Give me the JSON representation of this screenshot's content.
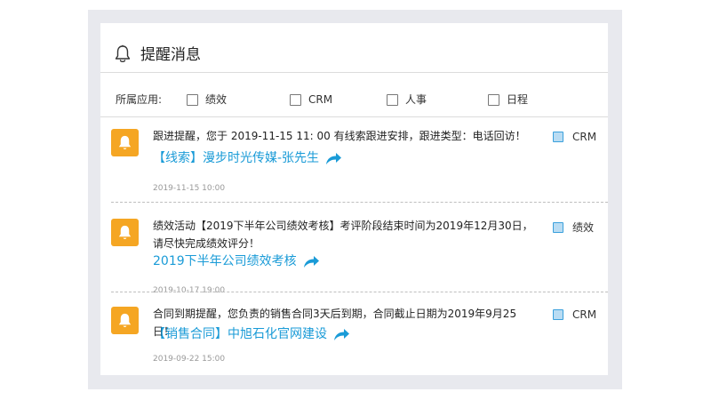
{
  "header": {
    "title": "提醒消息",
    "icon": "bell-icon"
  },
  "filter": {
    "label": "所属应用:",
    "options": [
      {
        "label": "绩效"
      },
      {
        "label": "CRM"
      },
      {
        "label": "人事"
      },
      {
        "label": "日程"
      }
    ]
  },
  "messages": [
    {
      "text": "跟进提醒，您于 2019-11-15  11: 00 有线索跟进安排，跟进类型：电话回访！",
      "link": "【线索】漫步时光传媒-张先生",
      "time": "2019-11-15  10:00",
      "tag": "CRM"
    },
    {
      "text": "绩效活动【2019下半年公司绩效考核】考评阶段结束时间为2019年12月30日，请尽快完成绩效评分！",
      "link": "2019下半年公司绩效考核",
      "time": "2019-10-17  19:00",
      "tag": "绩效"
    },
    {
      "text": "合同到期提醒，您负责的销售合同3天后到期，合同截止日期为2019年9月25日！",
      "link": "【销售合同】中旭石化官网建设",
      "time": "2019-09-22  15:00",
      "tag": "CRM"
    }
  ],
  "colors": {
    "badge": "#f5a623",
    "link": "#1a9bd7",
    "tag": "#b9dcf3",
    "frame": "#e8e9ee"
  }
}
